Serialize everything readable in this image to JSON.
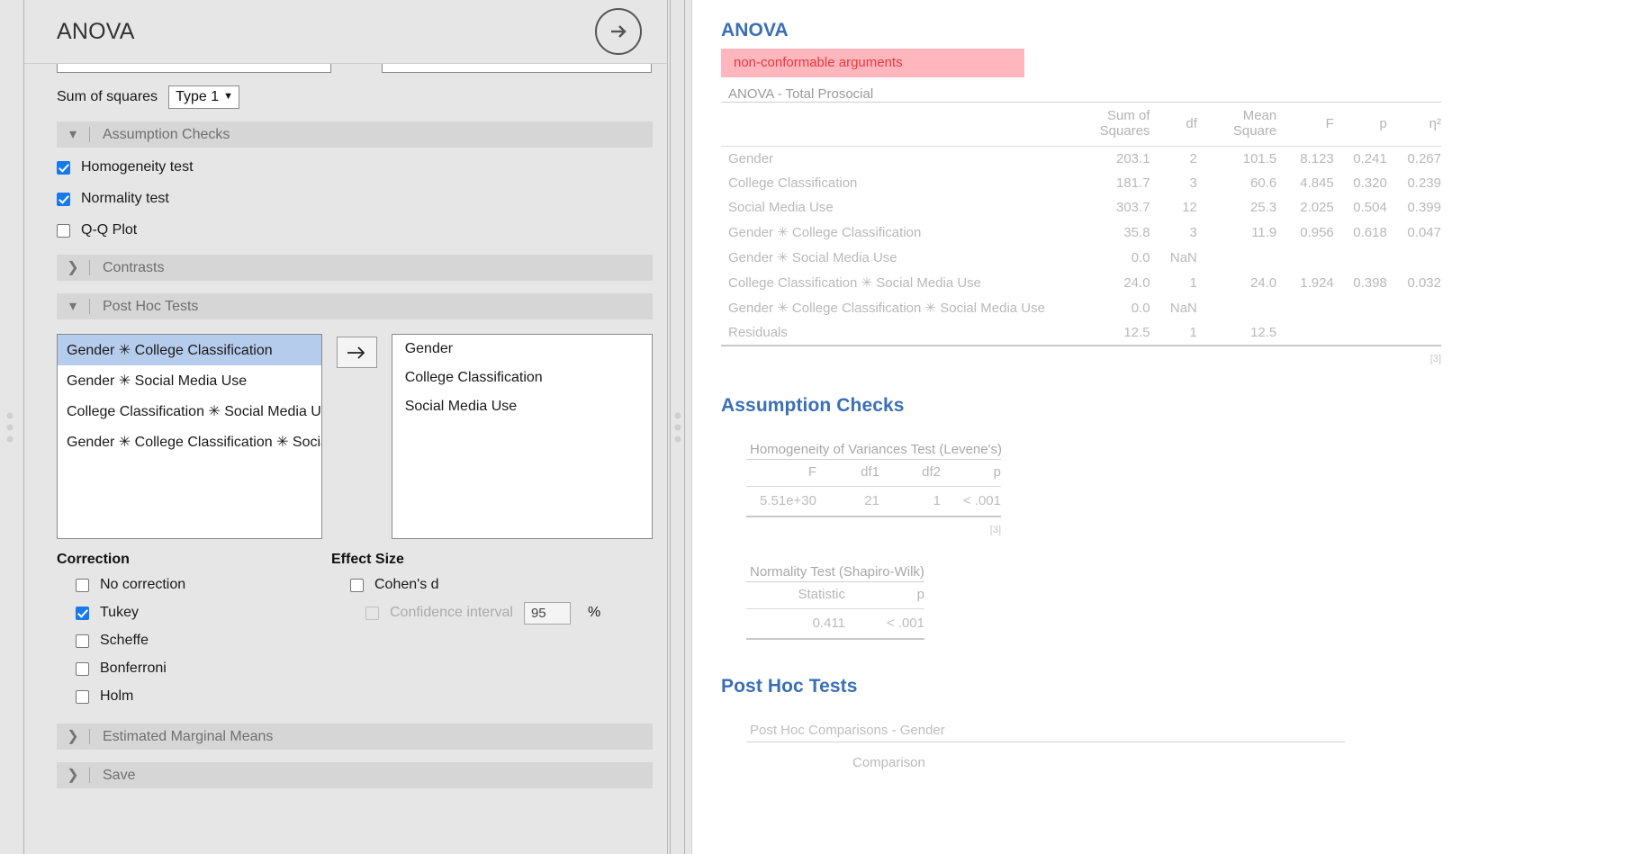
{
  "options_panel": {
    "title": "ANOVA",
    "forward_icon": "arrow-right-circle-icon",
    "sum_of_squares": {
      "label": "Sum of squares",
      "value": "Type 1",
      "caret": "⌄"
    },
    "sections": {
      "assumption_checks": {
        "label": "Assumption Checks",
        "chevron": "⌄",
        "expanded": true
      },
      "contrasts": {
        "label": "Contrasts",
        "chevron": "›",
        "expanded": false
      },
      "post_hoc_tests": {
        "label": "Post Hoc Tests",
        "chevron": "⌄",
        "expanded": true
      },
      "estimated_marginal_means": {
        "label": "Estimated Marginal Means",
        "chevron": "›",
        "expanded": false
      },
      "save": {
        "label": "Save",
        "chevron": "›",
        "expanded": false
      }
    },
    "assumption_options": [
      {
        "label": "Homogeneity test",
        "checked": true
      },
      {
        "label": "Normality test",
        "checked": true
      },
      {
        "label": "Q-Q Plot",
        "checked": false
      }
    ],
    "post_hoc": {
      "available": [
        {
          "label": "Gender ✳ College Classification",
          "selected": true
        },
        {
          "label": "Gender ✳ Social Media Use",
          "selected": false
        },
        {
          "label": "College Classification ✳ Social Media Use",
          "selected": false
        },
        {
          "label": "Gender ✳ College Classification ✳ Social M",
          "selected": false
        }
      ],
      "assigned": [
        "Gender",
        "College Classification",
        "Social Media Use"
      ],
      "transfer_icon": "arrow-right-icon"
    },
    "correction": {
      "title": "Correction",
      "items": [
        {
          "label": "No correction",
          "checked": false
        },
        {
          "label": "Tukey",
          "checked": true
        },
        {
          "label": "Scheffe",
          "checked": false
        },
        {
          "label": "Bonferroni",
          "checked": false
        },
        {
          "label": "Holm",
          "checked": false
        }
      ]
    },
    "effect_size": {
      "title": "Effect Size",
      "cohens_d": {
        "label": "Cohen's d",
        "checked": false
      },
      "confidence_interval": {
        "label": "Confidence interval",
        "checked": false,
        "value": "95",
        "unit": "%"
      }
    }
  },
  "results": {
    "title": "ANOVA",
    "error": "non-conformable arguments",
    "anova_table": {
      "caption": "ANOVA - Total Prosocial",
      "columns": [
        "",
        "Sum of Squares",
        "df",
        "Mean Square",
        "F",
        "p",
        "η²"
      ],
      "rows": [
        {
          "term": "Gender",
          "ss": "203.1",
          "df": "2",
          "ms": "101.5",
          "f": "8.123",
          "p": "0.241",
          "eta": "0.267"
        },
        {
          "term": "College Classification",
          "ss": "181.7",
          "df": "3",
          "ms": "60.6",
          "f": "4.845",
          "p": "0.320",
          "eta": "0.239"
        },
        {
          "term": "Social Media Use",
          "ss": "303.7",
          "df": "12",
          "ms": "25.3",
          "f": "2.025",
          "p": "0.504",
          "eta": "0.399"
        },
        {
          "term": "Gender ✳ College Classification",
          "ss": "35.8",
          "df": "3",
          "ms": "11.9",
          "f": "0.956",
          "p": "0.618",
          "eta": "0.047"
        },
        {
          "term": "Gender ✳ Social Media Use",
          "ss": "0.0",
          "df": "NaN",
          "ms": "",
          "f": "",
          "p": "",
          "eta": ""
        },
        {
          "term": "College Classification ✳ Social Media Use",
          "ss": "24.0",
          "df": "1",
          "ms": "24.0",
          "f": "1.924",
          "p": "0.398",
          "eta": "0.032"
        },
        {
          "term": "Gender ✳ College Classification ✳ Social Media Use",
          "ss": "0.0",
          "df": "NaN",
          "ms": "",
          "f": "",
          "p": "",
          "eta": ""
        },
        {
          "term": "Residuals",
          "ss": "12.5",
          "df": "1",
          "ms": "12.5",
          "f": "",
          "p": "",
          "eta": ""
        }
      ],
      "footnote": "[3]"
    },
    "assumption_checks": {
      "title": "Assumption Checks",
      "levene": {
        "caption": "Homogeneity of Variances Test (Levene's)",
        "columns": [
          "F",
          "df1",
          "df2",
          "p"
        ],
        "values": [
          "5.51e+30",
          "21",
          "1",
          "< .001"
        ],
        "footnote": "[3]"
      },
      "shapiro": {
        "caption": "Normality Test (Shapiro-Wilk)",
        "columns": [
          "Statistic",
          "p"
        ],
        "values": [
          "0.411",
          "< .001"
        ]
      }
    },
    "post_hoc": {
      "title": "Post Hoc Tests",
      "caption": "Post Hoc Comparisons - Gender",
      "column_group": "Comparison"
    }
  }
}
